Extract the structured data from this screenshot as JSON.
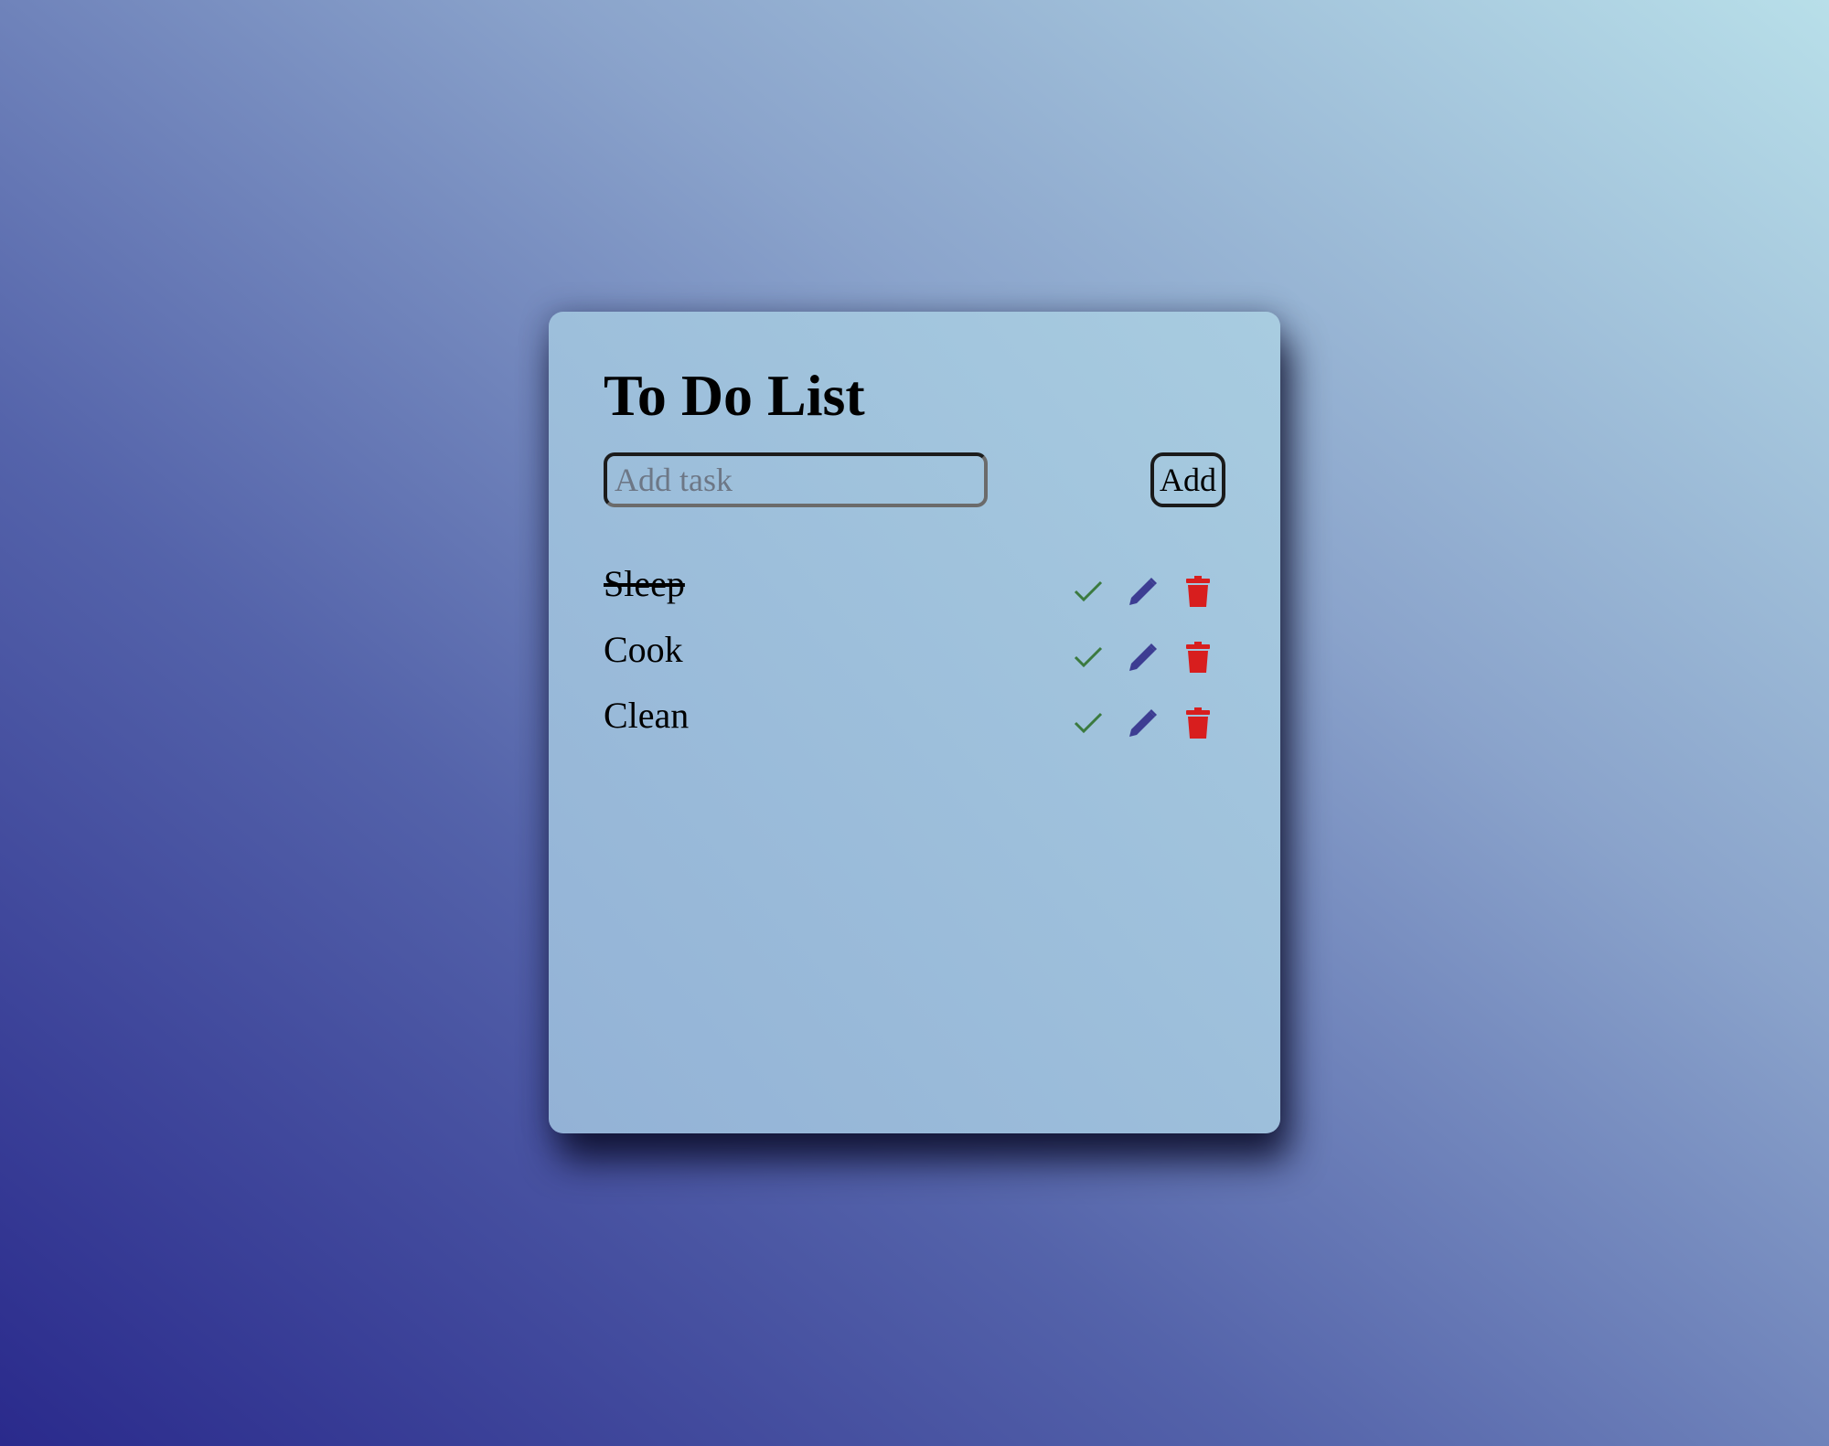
{
  "app": {
    "title": "To Do List"
  },
  "input": {
    "placeholder": "Add task",
    "value": ""
  },
  "add_button": {
    "label": "Add"
  },
  "tasks": [
    {
      "text": "Sleep",
      "completed": true
    },
    {
      "text": "Cook",
      "completed": false
    },
    {
      "text": "Clean",
      "completed": false
    }
  ],
  "icons": {
    "complete": "check-icon",
    "edit": "pencil-icon",
    "delete": "trash-icon"
  },
  "colors": {
    "check": "#3b7a3f",
    "edit": "#3d3d92",
    "delete": "#d81e1e"
  }
}
